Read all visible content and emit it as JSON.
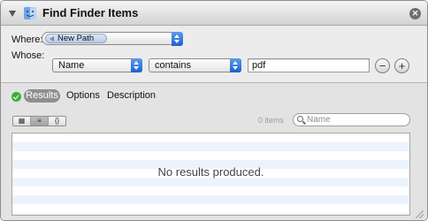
{
  "action": {
    "title": "Find Finder Items",
    "icon": "finder-icon"
  },
  "options": {
    "where_label": "Where:",
    "where_value": "New Path",
    "whose_label": "Whose:",
    "attribute_value": "Name",
    "operator_value": "contains",
    "text_value": "pdf",
    "remove_label": "−",
    "add_label": "+"
  },
  "tabs": [
    {
      "label": "Results",
      "active": true
    },
    {
      "label": "Options",
      "active": false
    },
    {
      "label": "Description",
      "active": false
    }
  ],
  "results": {
    "view_modes": [
      "▦",
      "≡",
      "{}"
    ],
    "items_count": "0 items",
    "search_placeholder": "Name",
    "empty_message": "No results produced."
  },
  "colors": {
    "accent": "#1d5fd0",
    "status_ok": "#3cae3a"
  }
}
